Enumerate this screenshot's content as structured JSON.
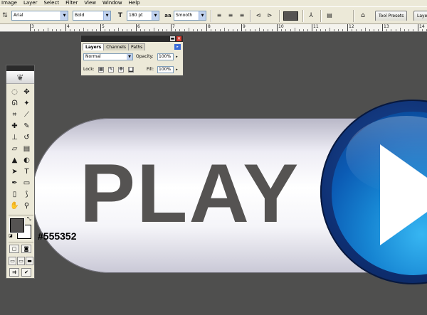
{
  "menubar": {
    "items": [
      "Image",
      "Layer",
      "Select",
      "Filter",
      "View",
      "Window",
      "Help"
    ]
  },
  "options_bar": {
    "font_family": "Arial",
    "font_style": "Bold",
    "font_size_icon": "T",
    "font_size": "180 pt",
    "aa_icon": "aa",
    "anti_alias": "Smooth",
    "text_color": "#555352",
    "palette_well_tabs": [
      "Tool Presets",
      "Laye"
    ]
  },
  "ruler": {
    "labels": [
      "3",
      "4",
      "5",
      "6",
      "7",
      "8",
      "9",
      "10",
      "11",
      "12",
      "13",
      "14"
    ]
  },
  "canvas": {
    "play_text": "PLAY",
    "color_note": "#555352",
    "colors": {
      "background": "#4f4f4e",
      "text": "#555352",
      "circle_dark": "#0e2f72",
      "circle_light": "#37b6f2",
      "triangle": "#ffffff"
    }
  },
  "layers_palette": {
    "tabs": [
      "Layers",
      "Channels",
      "Paths"
    ],
    "active_tab": "Layers",
    "blend_mode": "Normal",
    "opacity_label": "Opacity:",
    "opacity_value": "100%",
    "lock_label": "Lock:",
    "fill_label": "Fill:",
    "fill_value": "100%",
    "menu_arrow": "▸"
  },
  "toolbox": {
    "tools": [
      {
        "name": "marquee-tool-icon",
        "glyph": "◌"
      },
      {
        "name": "move-tool-icon",
        "glyph": "✥"
      },
      {
        "name": "lasso-tool-icon",
        "glyph": "ᘏ"
      },
      {
        "name": "magic-wand-tool-icon",
        "glyph": "✦"
      },
      {
        "name": "crop-tool-icon",
        "glyph": "⌗"
      },
      {
        "name": "slice-tool-icon",
        "glyph": "⟋"
      },
      {
        "name": "healing-brush-tool-icon",
        "glyph": "✚"
      },
      {
        "name": "brush-tool-icon",
        "glyph": "✎"
      },
      {
        "name": "clone-stamp-tool-icon",
        "glyph": "⊥"
      },
      {
        "name": "history-brush-tool-icon",
        "glyph": "↺"
      },
      {
        "name": "eraser-tool-icon",
        "glyph": "▱"
      },
      {
        "name": "gradient-tool-icon",
        "glyph": "▤"
      },
      {
        "name": "blur-tool-icon",
        "glyph": "▲"
      },
      {
        "name": "dodge-tool-icon",
        "glyph": "◐"
      },
      {
        "name": "path-selection-tool-icon",
        "glyph": "➤"
      },
      {
        "name": "type-tool-icon",
        "glyph": "T"
      },
      {
        "name": "pen-tool-icon",
        "glyph": "✒"
      },
      {
        "name": "shape-tool-icon",
        "glyph": "▭"
      },
      {
        "name": "notes-tool-icon",
        "glyph": "▯"
      },
      {
        "name": "eyedropper-tool-icon",
        "glyph": "⟆"
      },
      {
        "name": "hand-tool-icon",
        "glyph": "✋"
      },
      {
        "name": "zoom-tool-icon",
        "glyph": "⚲"
      }
    ],
    "foreground_color": "#555352",
    "background_color": "#ffffff"
  }
}
